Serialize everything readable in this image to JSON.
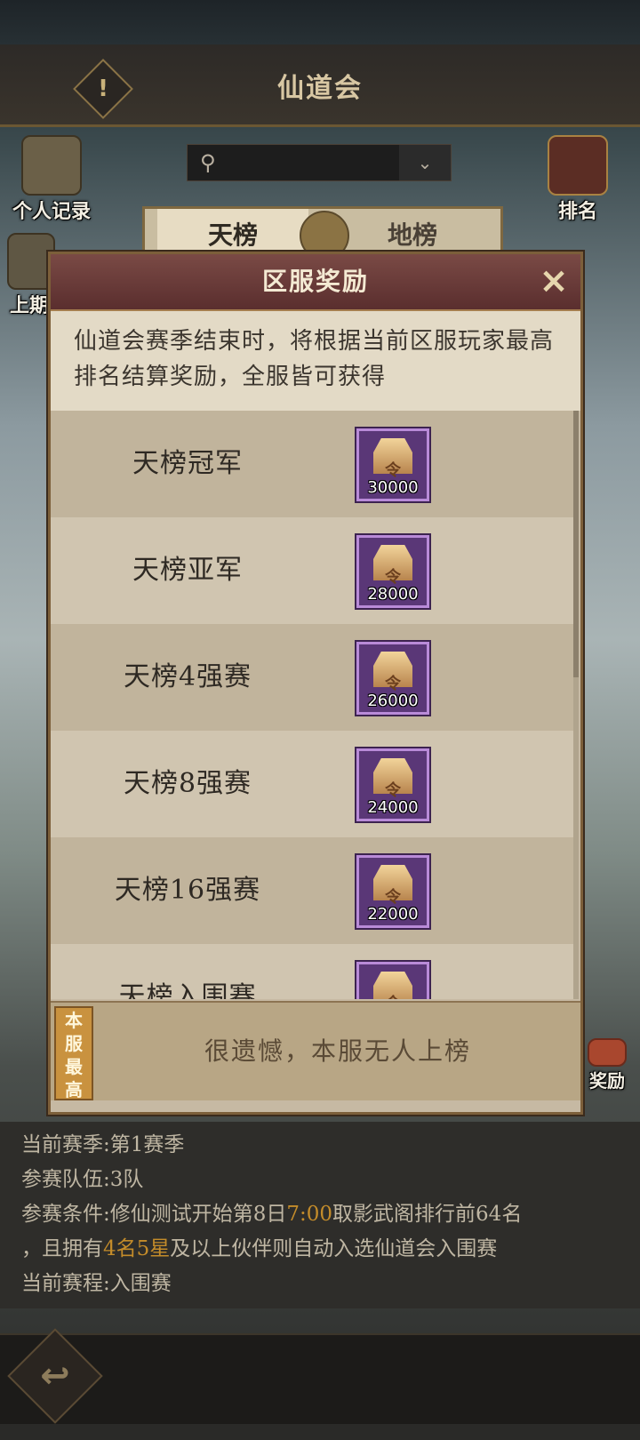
{
  "header": {
    "title": "仙道会",
    "warn_icon": "!"
  },
  "server_select": {
    "value": "",
    "pin_icon": "map-pin-icon",
    "dropdown_icon": "chevron-down-icon"
  },
  "side_buttons": {
    "personal_record": "个人记录",
    "ranking": "排名",
    "last_period": "上期",
    "rewards": "奖励"
  },
  "tabs": [
    {
      "label": "天榜"
    },
    {
      "label": "地榜"
    }
  ],
  "modal": {
    "title": "区服奖励",
    "close_icon": "×",
    "intro": "仙道会赛季结束时，将根据当前区服玩家最高排名结算奖励，全服皆可获得",
    "rows": [
      {
        "label": "天榜冠军",
        "qty": "30000",
        "glyph": "令"
      },
      {
        "label": "天榜亚军",
        "qty": "28000",
        "glyph": "令"
      },
      {
        "label": "天榜4强赛",
        "qty": "26000",
        "glyph": "令"
      },
      {
        "label": "天榜8强赛",
        "qty": "24000",
        "glyph": "令"
      },
      {
        "label": "天榜16强赛",
        "qty": "22000",
        "glyph": "令"
      },
      {
        "label": "天榜入围赛",
        "qty": "",
        "glyph": "令"
      }
    ],
    "best_tag": [
      "本",
      "服",
      "最",
      "高"
    ],
    "best_text": "很遗憾，本服无人上榜"
  },
  "info": {
    "season": "当前赛季:第1赛季",
    "teams": "参赛队伍:3队",
    "cond_prefix": "参赛条件:修仙测试开始第8日",
    "cond_time": "7:00",
    "cond_suffix": "取影武阁排行前64名",
    "line2_prefix": "，且拥有",
    "line2_hl": "4名5星",
    "line2_suffix": "及以上伙伴则自动入选仙道会入围赛",
    "schedule": "当前赛程:入围赛"
  },
  "colors": {
    "modal_header": "#6a3b39",
    "reward_frame": "#5a3777",
    "highlight": "#c48c2a"
  }
}
